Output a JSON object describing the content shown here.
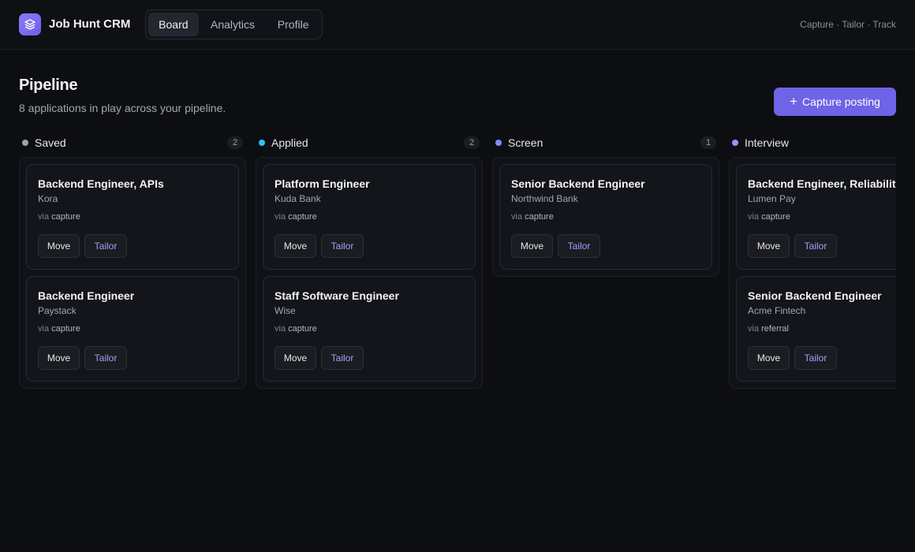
{
  "app": {
    "title": "Job Hunt CRM",
    "tagline": "Capture · Tailor · Track"
  },
  "nav": {
    "tabs": [
      {
        "label": "Board"
      },
      {
        "label": "Analytics"
      },
      {
        "label": "Profile"
      }
    ],
    "active": "Board"
  },
  "page": {
    "title": "Pipeline",
    "subtitle": "8 applications in play across your pipeline.",
    "capture_label": "Capture posting"
  },
  "colors": {
    "accent": "#6f63e6",
    "saved": "#9aa3b5",
    "applied": "#38bdf8",
    "screen": "#818cf8",
    "interview": "#a78bfa"
  },
  "board": {
    "columns": [
      {
        "name": "Saved",
        "count": "2",
        "dot": "#9aa3b5",
        "cards": [
          {
            "title": "Backend Engineer, APIs",
            "company": "Kora",
            "via": "via",
            "source": "capture",
            "move": "Move",
            "tailor": "Tailor"
          },
          {
            "title": "Backend Engineer",
            "company": "Paystack",
            "via": "via",
            "source": "capture",
            "move": "Move",
            "tailor": "Tailor"
          }
        ]
      },
      {
        "name": "Applied",
        "count": "2",
        "dot": "#38bdf8",
        "cards": [
          {
            "title": "Platform Engineer",
            "company": "Kuda Bank",
            "via": "via",
            "source": "capture",
            "move": "Move",
            "tailor": "Tailor"
          },
          {
            "title": "Staff Software Engineer",
            "company": "Wise",
            "via": "via",
            "source": "capture",
            "move": "Move",
            "tailor": "Tailor"
          }
        ]
      },
      {
        "name": "Screen",
        "count": "1",
        "dot": "#818cf8",
        "cards": [
          {
            "title": "Senior Backend Engineer",
            "company": "Northwind Bank",
            "via": "via",
            "source": "capture",
            "move": "Move",
            "tailor": "Tailor"
          }
        ]
      },
      {
        "name": "Interview",
        "count": "",
        "dot": "#a78bfa",
        "cards": [
          {
            "title": "Backend Engineer, Reliability",
            "company": "Lumen Pay",
            "via": "via",
            "source": "capture",
            "move": "Move",
            "tailor": "Tailor"
          },
          {
            "title": "Senior Backend Engineer",
            "company": "Acme Fintech",
            "via": "via",
            "source": "referral",
            "move": "Move",
            "tailor": "Tailor"
          }
        ]
      }
    ]
  }
}
